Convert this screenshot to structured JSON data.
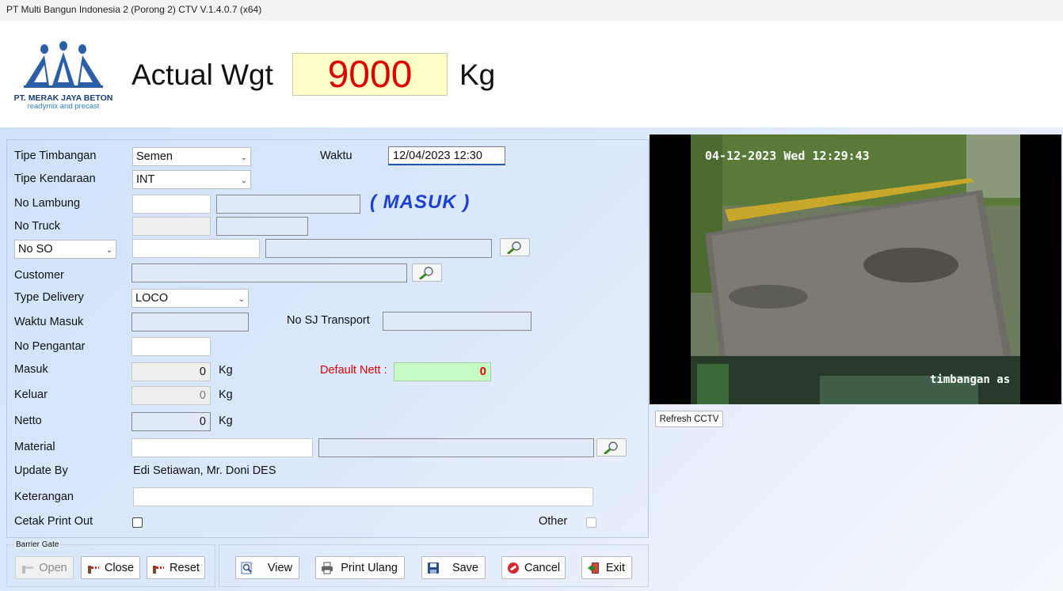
{
  "window": {
    "title": "PT Multi Bangun Indonesia 2 (Porong 2) CTV V.1.4.0.7 (x64)"
  },
  "logo": {
    "company": "PT. MERAK JAYA BETON",
    "tagline": "readymix and precast"
  },
  "weight": {
    "label": "Actual Wgt",
    "value": "9000",
    "unit": "Kg"
  },
  "form": {
    "tipe_timbangan": {
      "label": "Tipe Timbangan",
      "value": "Semen"
    },
    "tipe_kendaraan": {
      "label": "Tipe Kendaraan",
      "value": "INT"
    },
    "waktu": {
      "label": "Waktu",
      "value": "12/04/2023 12:30"
    },
    "no_lambung": {
      "label": "No Lambung",
      "value": "",
      "extra": ""
    },
    "status": "( MASUK )",
    "no_truck": {
      "label": "No Truck",
      "value": "",
      "extra": ""
    },
    "no_so": {
      "label": "No SO",
      "value": "",
      "extra": ""
    },
    "customer": {
      "label": "Customer",
      "value": ""
    },
    "type_delivery": {
      "label": "Type Delivery",
      "value": "LOCO"
    },
    "waktu_masuk": {
      "label": "Waktu Masuk",
      "value": ""
    },
    "no_sj_transport": {
      "label": "No SJ Transport",
      "value": ""
    },
    "no_pengantar": {
      "label": "No Pengantar",
      "value": ""
    },
    "masuk": {
      "label": "Masuk",
      "value": "0",
      "unit": "Kg"
    },
    "default_nett": {
      "label": "Default Nett :",
      "value": "0"
    },
    "keluar": {
      "label": "Keluar",
      "value": "0",
      "unit": "Kg"
    },
    "netto": {
      "label": "Netto",
      "value": "0",
      "unit": "Kg"
    },
    "material": {
      "label": "Material",
      "value": "",
      "extra": ""
    },
    "update_by": {
      "label": "Update By",
      "value": "Edi Setiawan, Mr. Doni DES"
    },
    "keterangan": {
      "label": "Keterangan",
      "value": ""
    },
    "cetak_print_out": {
      "label": "Cetak Print Out",
      "checked": false
    },
    "other": {
      "label": "Other",
      "checked": false
    }
  },
  "barrier_gate": {
    "label": "Barrier Gate",
    "open": "Open",
    "close": "Close",
    "reset": "Reset"
  },
  "actions": {
    "view": "View",
    "print_ulang": "Print Ulang",
    "save": "Save",
    "cancel": "Cancel",
    "exit": "Exit"
  },
  "cctv": {
    "timestamp": "04-12-2023 Wed 12:29:43",
    "caption": "timbangan as",
    "refresh": "Refresh CCTV"
  },
  "colors": {
    "weight_bg": "#ffffc8",
    "weight_text": "#e00000",
    "status_text": "#1b3fd8",
    "default_nett_label": "#e00000",
    "default_nett_bg": "#c6fcc4"
  }
}
